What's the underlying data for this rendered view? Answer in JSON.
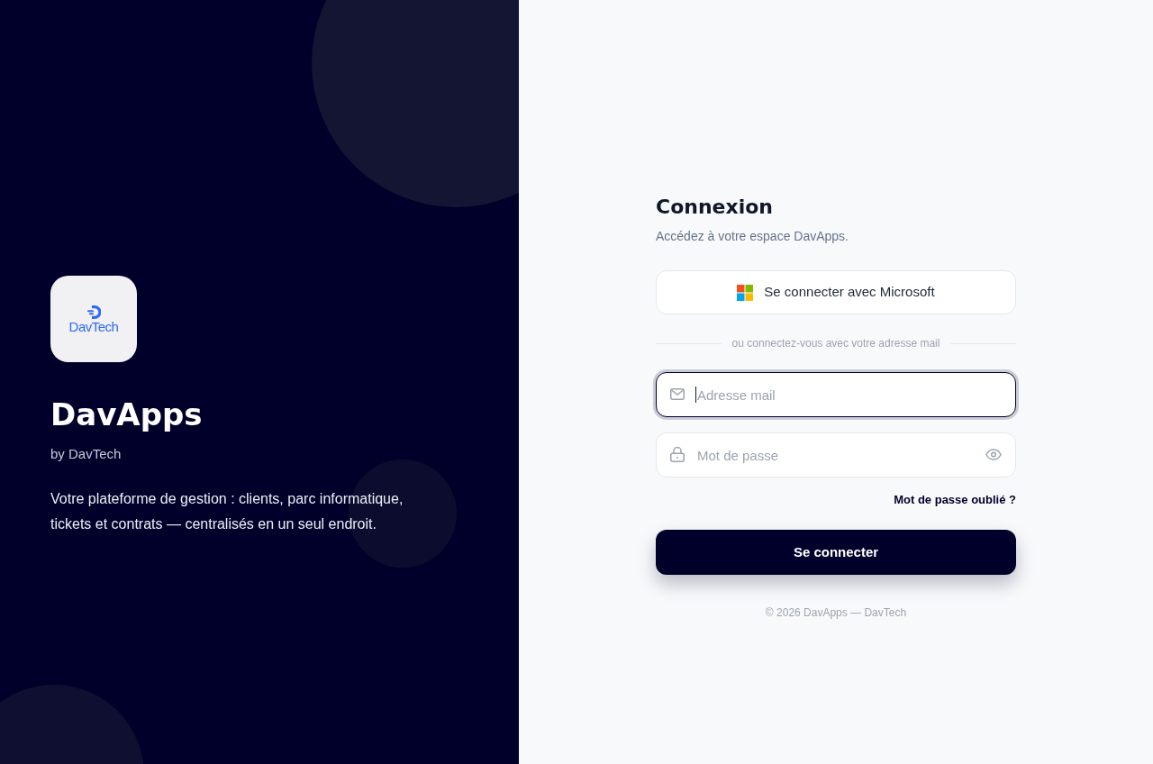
{
  "brand_panel": {
    "logo": {
      "text": "DavTech"
    },
    "title": "DavApps",
    "subtitle": "by DavTech",
    "description": "Votre plateforme de gestion : clients, parc informatique, tickets et contrats — centralisés en un seul endroit."
  },
  "login": {
    "title": "Connexion",
    "subtitle": "Accédez à votre espace DavApps.",
    "sso_button": "Se connecter avec Microsoft",
    "divider": "ou connectez-vous avec votre adresse mail",
    "fields": [
      {
        "kind": "email",
        "placeholder": "Adresse mail",
        "focused": true
      },
      {
        "kind": "password",
        "placeholder": "Mot de passe",
        "focused": false
      }
    ],
    "forgot_link": "Mot de passe oublié ?",
    "submit_button": "Se connecter",
    "footer": "© 2026 DavApps — DavTech"
  }
}
